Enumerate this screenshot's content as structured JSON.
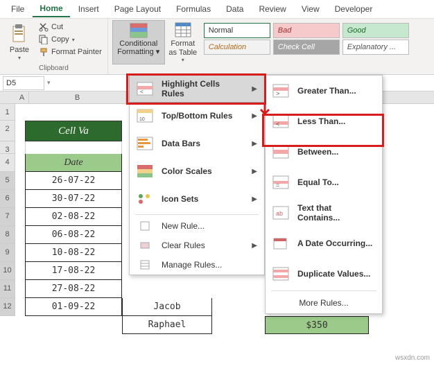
{
  "tabs": [
    "File",
    "Home",
    "Insert",
    "Page Layout",
    "Formulas",
    "Data",
    "Review",
    "View",
    "Developer"
  ],
  "active_tab": "Home",
  "clipboard": {
    "paste": "Paste",
    "cut": "Cut",
    "copy": "Copy",
    "painter": "Format Painter",
    "group": "Clipboard"
  },
  "cond_fmt": {
    "label": "Conditional Formatting",
    "format_table": "Format as Table"
  },
  "styles": {
    "normal": "Normal",
    "bad": "Bad",
    "good": "Good",
    "calc": "Calculation",
    "check": "Check Cell",
    "expl": "Explanatory ..."
  },
  "namebox": "D5",
  "cols": [
    "A",
    "B"
  ],
  "rows": [
    "1",
    "2",
    "3",
    "4",
    "5",
    "6",
    "7",
    "8",
    "9",
    "10",
    "11",
    "12"
  ],
  "table": {
    "title": "Cell Va",
    "header": "Date",
    "dates": [
      "26-07-22",
      "30-07-22",
      "02-08-22",
      "06-08-22",
      "10-08-22",
      "17-08-22",
      "27-08-22",
      "01-09-22"
    ],
    "names": [
      "Jacob",
      "Raphael"
    ],
    "price": "$350"
  },
  "menu1": {
    "items": [
      {
        "label": "Highlight Cells Rules",
        "arrow": true,
        "hover": true,
        "icon": "highlight"
      },
      {
        "label": "Top/Bottom Rules",
        "arrow": true,
        "icon": "topbottom"
      },
      {
        "label": "Data Bars",
        "arrow": true,
        "icon": "databars"
      },
      {
        "label": "Color Scales",
        "arrow": true,
        "icon": "colorscales"
      },
      {
        "label": "Icon Sets",
        "arrow": true,
        "icon": "iconsets"
      }
    ],
    "extra": [
      {
        "label": "New Rule...",
        "icon": "new"
      },
      {
        "label": "Clear Rules",
        "arrow": true,
        "icon": "clear"
      },
      {
        "label": "Manage Rules...",
        "icon": "manage"
      }
    ]
  },
  "menu2": {
    "items": [
      {
        "label": "Greater Than...",
        "icon": "gt"
      },
      {
        "label": "Less Than...",
        "icon": "lt",
        "hl": true
      },
      {
        "label": "Between...",
        "icon": "between"
      },
      {
        "label": "Equal To...",
        "icon": "eq"
      },
      {
        "label": "Text that Contains...",
        "icon": "text"
      },
      {
        "label": "A Date Occurring...",
        "icon": "date"
      },
      {
        "label": "Duplicate Values...",
        "icon": "dup"
      }
    ],
    "more": "More Rules..."
  },
  "watermark": "wsxdn.com"
}
